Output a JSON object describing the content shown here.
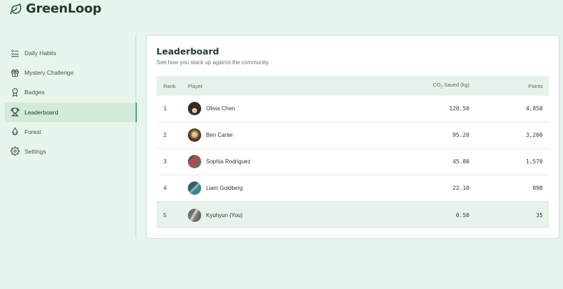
{
  "app": {
    "name": "GreenLoop"
  },
  "sidebar": {
    "items": [
      {
        "label": "Daily Habits",
        "icon": "list-check-icon",
        "active": false
      },
      {
        "label": "Mystery Challenge",
        "icon": "gift-icon",
        "active": false
      },
      {
        "label": "Badges",
        "icon": "award-icon",
        "active": false
      },
      {
        "label": "Leaderboard",
        "icon": "trophy-icon",
        "active": true
      },
      {
        "label": "Forest",
        "icon": "tree-icon",
        "active": false
      },
      {
        "label": "Settings",
        "icon": "gear-icon",
        "active": false
      }
    ]
  },
  "leaderboard": {
    "title": "Leaderboard",
    "subtitle": "See how you stack up against the community.",
    "columns": {
      "rank": "Rank",
      "player": "Player",
      "co2_prefix": "CO",
      "co2_sub": "2",
      "co2_suffix": " Saved (kg)",
      "points": "Points"
    },
    "rows": [
      {
        "rank": "1",
        "player": "Olivia Chen",
        "co2": "120.50",
        "points": "4,850",
        "avatar_color": "#3a2a22"
      },
      {
        "rank": "2",
        "player": "Ben Carter",
        "co2": "95.20",
        "points": "3,200",
        "avatar_color": "#6b4a2e"
      },
      {
        "rank": "3",
        "player": "Sophia Rodriguez",
        "co2": "45.80",
        "points": "1,570",
        "avatar_color": "#8a4a4a"
      },
      {
        "rank": "4",
        "player": "Liam Goldberg",
        "co2": "22.10",
        "points": "890",
        "avatar_color": "#3e7f8a"
      },
      {
        "rank": "5",
        "player": "Kyuhyun (You)",
        "co2": "0.50",
        "points": "35",
        "avatar_color": "#8a8a8a"
      }
    ]
  },
  "colors": {
    "background": "#e8f5ec",
    "accent": "#5aa56e",
    "brand": "#1f3d2a"
  }
}
